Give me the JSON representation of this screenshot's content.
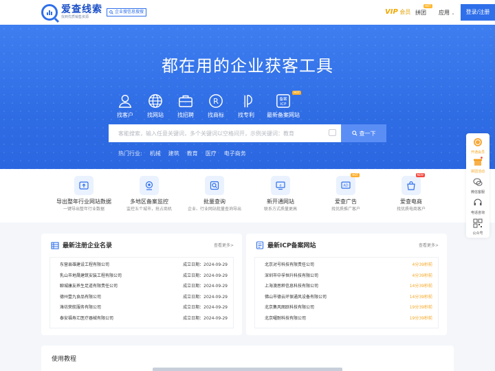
{
  "header": {
    "logo_title": "爱查线索",
    "logo_slogan": "找到优质销售资源",
    "logo_tag": "企业搜信息搜搜",
    "vip_label": "VIP",
    "vip_text": "会员",
    "group_buy": "拼团",
    "group_hot": "HOT",
    "apps": "应用",
    "login": "登录/注册"
  },
  "hero": {
    "title": "都在用的企业获客工具",
    "tabs": [
      {
        "label": "找客户",
        "icon": "user-icon"
      },
      {
        "label": "找网站",
        "icon": "globe-icon"
      },
      {
        "label": "找招聘",
        "icon": "briefcase-icon"
      },
      {
        "label": "找商标",
        "icon": "trademark-icon"
      },
      {
        "label": "找专利",
        "icon": "patent-icon"
      },
      {
        "label": "最新备案网站",
        "icon": "icp-icon",
        "badge": "HOT"
      }
    ],
    "search_placeholder": "客能搜索，输入任意关键词，多个关键词以空格间开，示例关键词：教育",
    "search_button": "查一下",
    "hot_label": "热门行业:",
    "hot_words": [
      "机械",
      "建筑",
      "教育",
      "医疗",
      "电子商务"
    ]
  },
  "features": [
    {
      "title": "导出整年行业网站数据",
      "desc": "一键导出整年行业数据",
      "icon": "upload-icon"
    },
    {
      "title": "多地区备案监控",
      "desc": "监控五个城市，抢占商机",
      "icon": "camera-icon"
    },
    {
      "title": "批量查询",
      "desc": "企业、行业网站批量查询导出",
      "icon": "search-doc-icon"
    },
    {
      "title": "新开通网站",
      "desc": "联系方式质量更高",
      "icon": "new-site-icon"
    },
    {
      "title": "爱查广告",
      "desc": "找优质推广客户",
      "icon": "ad-icon",
      "badge": "HOT"
    },
    {
      "title": "爱查电商",
      "desc": "找优质电商客户",
      "icon": "shop-icon",
      "badge": "NEW"
    }
  ],
  "floatbar": [
    {
      "label": "开通会员",
      "icon": "vip-icon"
    },
    {
      "label": "拼团活动",
      "icon": "gift-icon"
    },
    {
      "label": "微信客服",
      "icon": "wechat-icon"
    },
    {
      "label": "电话咨询",
      "icon": "phone-icon"
    },
    {
      "label": "公众号",
      "icon": "qrcode-icon"
    }
  ],
  "panel_companies": {
    "title": "最新注册企业名录",
    "more": "查看更多>",
    "rows": [
      {
        "name": "东营县雄建设工程有限公司",
        "meta": "成立日期：2024-09-29"
      },
      {
        "name": "乳山市地晟建筑安装工程有限公司",
        "meta": "成立日期：2024-09-29"
      },
      {
        "name": "聊城康友养生足道有限责任公司",
        "meta": "成立日期：2024-09-29"
      },
      {
        "name": "德州壹九食品有限公司",
        "meta": "成立日期：2024-09-29"
      },
      {
        "name": "潍坊荣航服务有限公司",
        "meta": "成立日期：2024-09-29"
      },
      {
        "name": "泰安福寿汇医疗器械有限公司",
        "meta": "成立日期：2024-09-29"
      }
    ]
  },
  "panel_icp": {
    "title": "最新ICP备案网站",
    "more": "查看更多>",
    "rows": [
      {
        "name": "北京对号科技有限责任公司",
        "meta": "4分39秒前"
      },
      {
        "name": "深圳市中孚恒升科技有限公司",
        "meta": "4分39秒前"
      },
      {
        "name": "上海澳思粹信息科技有限公司",
        "meta": "14分39秒前"
      },
      {
        "name": "佛山市德云环保通风设备有限公司",
        "meta": "14分39秒前"
      },
      {
        "name": "北京集风图跃科技有限公司",
        "meta": "19分39秒前"
      },
      {
        "name": "北京曜耐科技有限公司",
        "meta": "19分39秒前"
      }
    ]
  },
  "tutorial": {
    "title": "使用教程"
  },
  "colors": {
    "primary": "#2f6fea",
    "hero": "#3472e8",
    "orange": "#f5a623"
  }
}
